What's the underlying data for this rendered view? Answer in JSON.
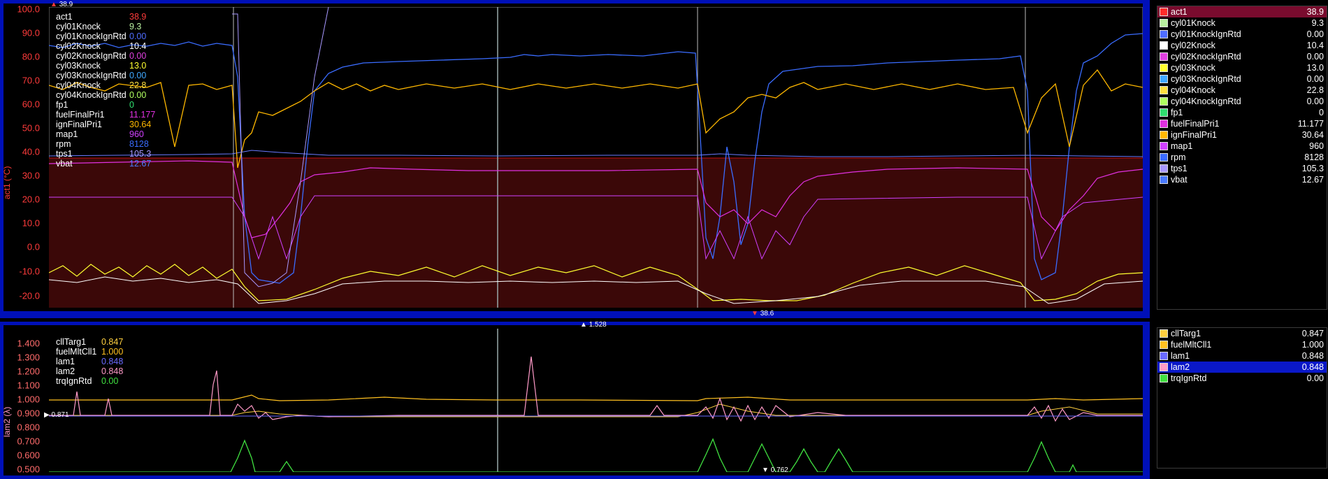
{
  "top_chart": {
    "y_title": "act1 (°C)",
    "y_ticks": [
      "100.0",
      "90.0",
      "80.0",
      "70.0",
      "60.0",
      "50.0",
      "40.0",
      "30.0",
      "20.0",
      "10.0",
      "0.0",
      "-10.0",
      "-20.0"
    ],
    "top_marker": "38.9",
    "bottom_marker": "38.6",
    "legend": [
      {
        "name": "act1",
        "value": "38.9",
        "color": "#ff2a2a"
      },
      {
        "name": "cyl01Knock",
        "value": "9.3",
        "color": "#b9f0a0"
      },
      {
        "name": "cyl01KnockIgnRtd",
        "value": "0.00",
        "color": "#4f6dff"
      },
      {
        "name": "cyl02Knock",
        "value": "10.4",
        "color": "#ffffff"
      },
      {
        "name": "cyl02KnockIgnRtd",
        "value": "0.00",
        "color": "#e040e0"
      },
      {
        "name": "cyl03Knock",
        "value": "13.0",
        "color": "#ffff30"
      },
      {
        "name": "cyl03KnockIgnRtd",
        "value": "0.00",
        "color": "#40a8ff"
      },
      {
        "name": "cyl04Knock",
        "value": "22.8",
        "color": "#ffe040"
      },
      {
        "name": "cyl04KnockIgnRtd",
        "value": "0.00",
        "color": "#b0ff60"
      },
      {
        "name": "fp1",
        "value": "0",
        "color": "#30e070"
      },
      {
        "name": "fuelFinalPri1",
        "value": "11.177",
        "color": "#e030e0"
      },
      {
        "name": "ignFinalPri1",
        "value": "30.64",
        "color": "#ffb800"
      },
      {
        "name": "map1",
        "value": "960",
        "color": "#d040ff"
      },
      {
        "name": "rpm",
        "value": "8128",
        "color": "#3a6cff"
      },
      {
        "name": "tps1",
        "value": "105.3",
        "color": "#a898ff"
      },
      {
        "name": "vbat",
        "value": "12.67",
        "color": "#4a7aff"
      }
    ]
  },
  "bottom_chart": {
    "y_title": "lam2 (λ)",
    "y_ticks": [
      "1.400",
      "1.300",
      "1.200",
      "1.100",
      "1.000",
      "0.900",
      "0.800",
      "0.700",
      "0.600",
      "0.500"
    ],
    "top_marker": "1.528",
    "bottom_marker": "0.762",
    "left_marker": "0.871",
    "legend": [
      {
        "name": "cllTarg1",
        "value": "0.847",
        "color": "#ffd040"
      },
      {
        "name": "fuelMltCll1",
        "value": "1.000",
        "color": "#ffc020"
      },
      {
        "name": "lam1",
        "value": "0.848",
        "color": "#6a6aff"
      },
      {
        "name": "lam2",
        "value": "0.848",
        "color": "#ff9ac8"
      },
      {
        "name": "trqIgnRtd",
        "value": "0.00",
        "color": "#40e040"
      }
    ]
  },
  "colors": {
    "frame": "#0010b8",
    "act_band": "#3b0808",
    "selected_row_top": "#7a0b2e",
    "selected_row_bottom": "#0a18c8"
  }
}
